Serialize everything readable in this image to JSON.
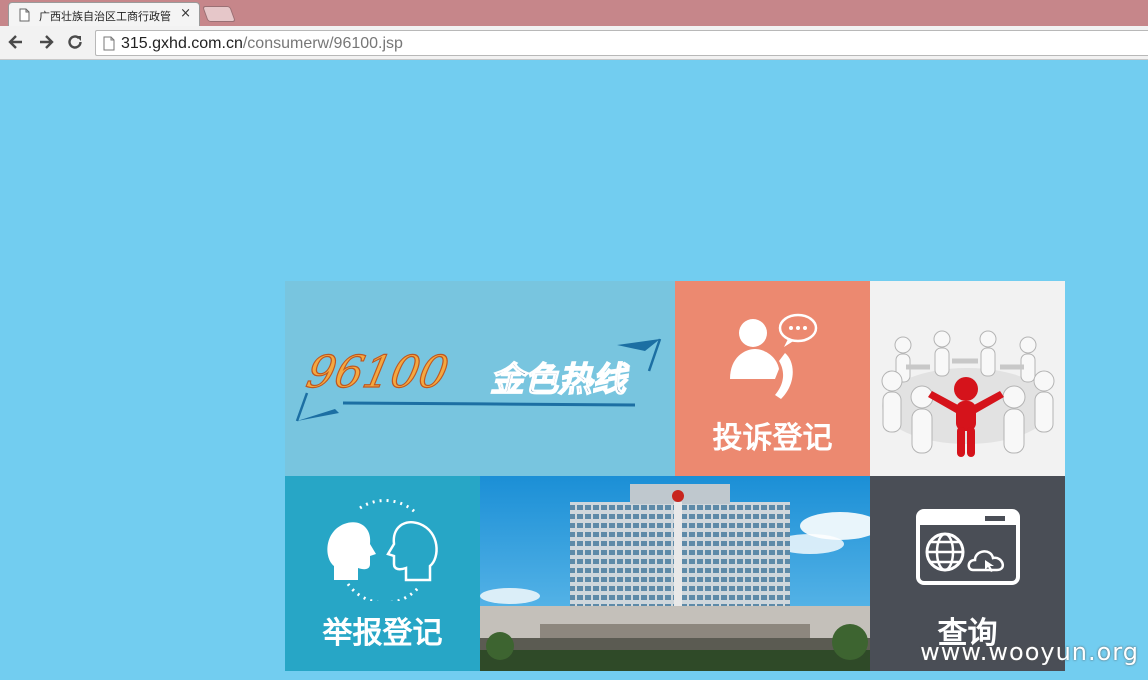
{
  "browser": {
    "tab_title": "广西壮族自治区工商行政管",
    "close_glyph": "×",
    "url_host": "315.gxhd.com.cn",
    "url_path": "/consumerw/96100.jsp"
  },
  "tiles": {
    "logo": {
      "number": "96100",
      "slogan": "金色热线"
    },
    "complaint": {
      "label": "投诉登记",
      "icon": "chat-phone-icon",
      "bg": "#ec8970"
    },
    "people": {
      "icon": "people-circle-image"
    },
    "report": {
      "label": "举报登记",
      "icon": "two-heads-icon",
      "bg": "#27a6c6"
    },
    "building": {
      "icon": "government-building-photo"
    },
    "query": {
      "label": "查询",
      "icon": "globe-cloud-window-icon",
      "bg": "#4a4e56"
    }
  },
  "watermark": "www.wooyun.org",
  "colors": {
    "page_bg": "#72cdf0",
    "tab_strip": "#c6868a"
  }
}
